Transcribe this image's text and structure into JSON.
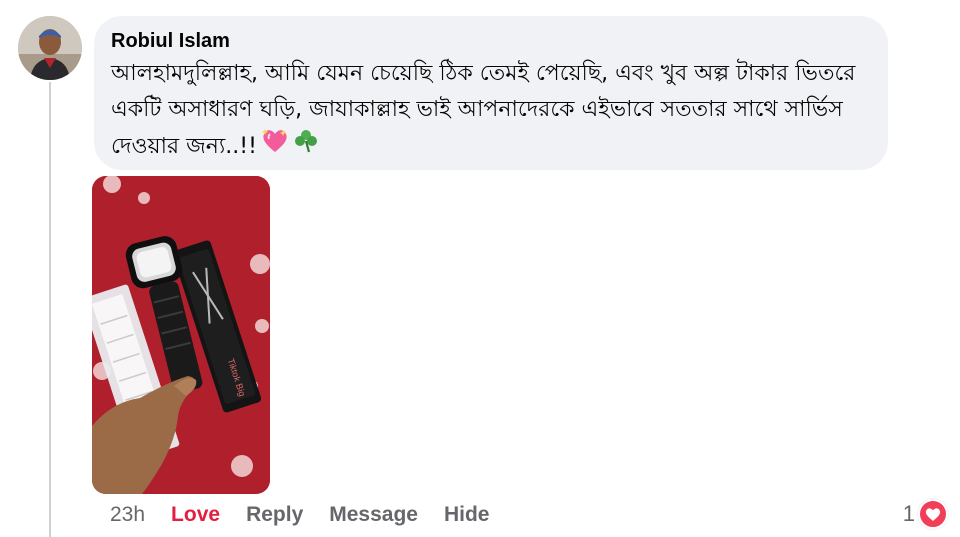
{
  "comment": {
    "author": "Robiul Islam",
    "text": "আলহামদুলিল্লাহ, আমি যেমন চেয়েছি ঠিক তেমই পেয়েছি, এবং খুব অল্প টাকার ভিতরে\nএকটি অসাধারণ ঘড়ি, জাযাকাল্লাহ ভাই আপনাদেরকে এইভাবে সততার সাথে সার্ভিস\nদেওয়ার জন্য..!!",
    "emojis": [
      "sparkling-heart-icon",
      "shamrock-icon"
    ],
    "photo": {
      "printed_text": "Tiktok Big"
    }
  },
  "actions": {
    "time": "23h",
    "love": "Love",
    "reply": "Reply",
    "message": "Message",
    "hide": "Hide"
  },
  "reactions": {
    "count": "1",
    "icon": "heart-reaction-icon"
  },
  "colors": {
    "bubble": "#f0f2f5",
    "love_active": "#e41e3f",
    "muted": "#65676b",
    "heart": "#f33e58"
  }
}
